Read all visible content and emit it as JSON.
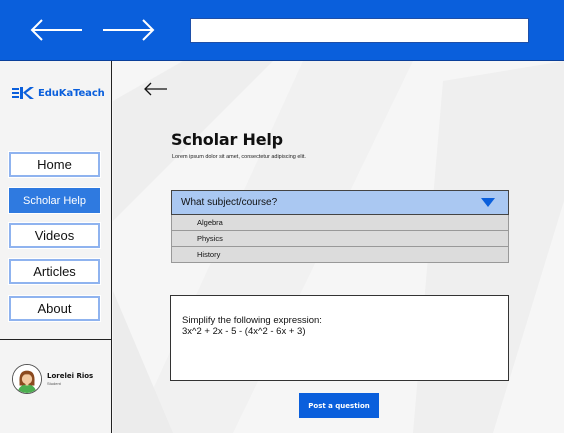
{
  "browser": {
    "back_icon": "arrow-left-icon",
    "forward_icon": "arrow-right-icon",
    "address_value": ""
  },
  "sidebar": {
    "logo_text": "EduKaTeach",
    "logo_icon": "edukateach-logo-icon",
    "nav": [
      {
        "label": "Home",
        "active": false
      },
      {
        "label": "Scholar Help",
        "active": true
      },
      {
        "label": "Videos",
        "active": false
      },
      {
        "label": "Articles",
        "active": false
      },
      {
        "label": "About",
        "active": false
      }
    ],
    "user": {
      "name": "Lorelei Rios",
      "role": "Student",
      "avatar_icon": "user-avatar-icon"
    }
  },
  "main": {
    "back_icon": "arrow-left-icon",
    "title": "Scholar Help",
    "subtitle": "Lorem ipsum dolor sit amet, consectetur adipiscing elit.",
    "subject_select": {
      "label": "What subject/course?",
      "caret_icon": "triangle-down-icon",
      "options": [
        "Algebra",
        "Physics",
        "History"
      ]
    },
    "question": "Simplify the following expression:\n3x^2 + 2x - 5 - (4x^2 - 6x + 3)",
    "post_button": "Post a question"
  },
  "colors": {
    "brand_blue": "#0a5fdc",
    "active_nav": "#2f7ae0",
    "nav_border": "#8fb3ef",
    "select_bg": "#aac8f2",
    "option_bg": "#dcdcdc"
  }
}
